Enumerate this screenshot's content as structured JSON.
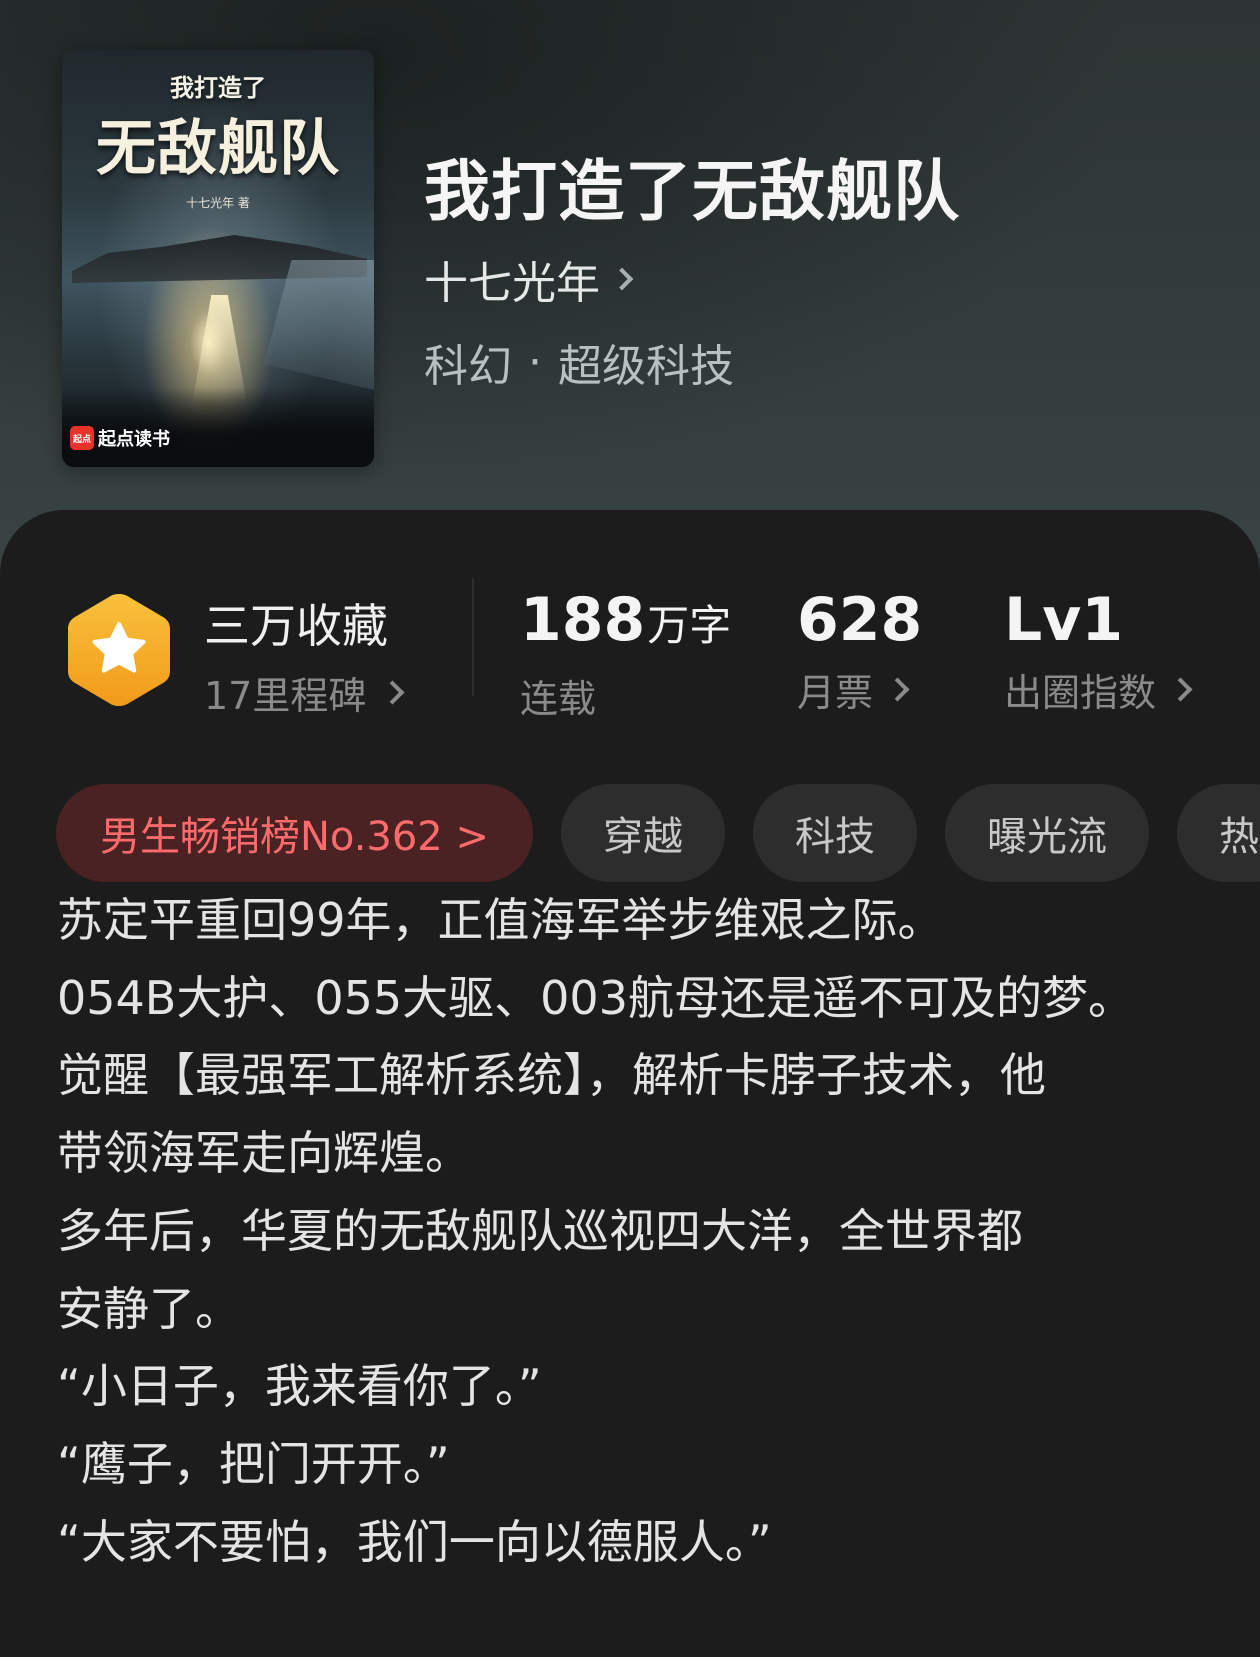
{
  "cover": {
    "small_title": "我打造了",
    "big_title": "无敌舰队",
    "author": "十七光年 著",
    "logo_mark": "起点",
    "logo_text": "起点读书"
  },
  "book": {
    "title": "我打造了无敌舰队",
    "author": "十七光年",
    "category": "科幻",
    "separator": "·",
    "subcategory": "超级科技"
  },
  "stats": {
    "collection": {
      "label": "三万收藏",
      "sub": "17里程碑"
    },
    "words": {
      "value": "188",
      "unit": "万字",
      "sub": "连载"
    },
    "votes": {
      "value": "628",
      "sub": "月票"
    },
    "influence": {
      "value": "Lv1",
      "sub": "出圈指数"
    }
  },
  "tags": [
    {
      "label": "男生畅销榜No.362 >"
    },
    {
      "label": "穿越"
    },
    {
      "label": "科技"
    },
    {
      "label": "曝光流"
    },
    {
      "label": "热"
    }
  ],
  "synopsis": [
    "苏定平重回99年，正值海军举步维艰之际。",
    "054B大护、055大驱、003航母还是遥不可及的梦。",
    "觉醒【最强军工解析系统】，解析卡脖子技术，他",
    "带领海军走向辉煌。",
    "多年后，华夏的无敌舰队巡视四大洋，全世界都",
    "安静了。",
    "“小日子，我来看你了。”",
    "“鹰子，把门开开。”",
    "“大家不要怕，我们一向以德服人。”"
  ],
  "colors": {
    "panel_bg": "#1c1c1c",
    "rank_tag_bg": "#4a2224",
    "rank_tag_text": "#ff6a6a",
    "badge_gold": "#f5a623"
  },
  "icons": {
    "badge": "star-hexagon-icon",
    "chevron": "chevron-right-icon"
  }
}
